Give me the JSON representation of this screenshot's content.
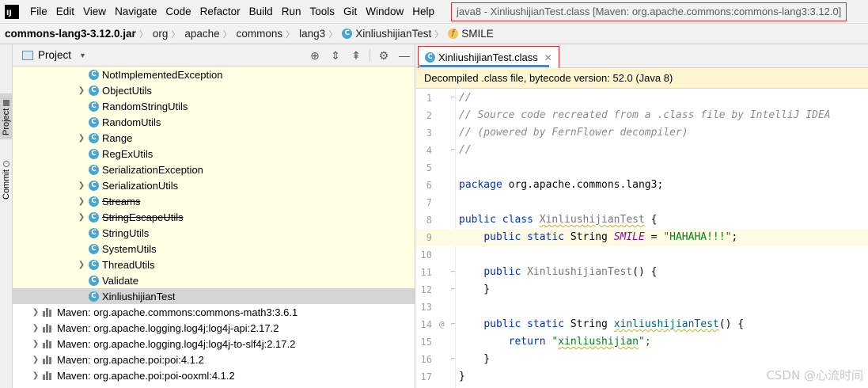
{
  "menubar": {
    "logo_text": "IJ",
    "items": [
      "File",
      "Edit",
      "View",
      "Navigate",
      "Code",
      "Refactor",
      "Build",
      "Run",
      "Tools",
      "Git",
      "Window",
      "Help"
    ],
    "window_title": "java8 - XinliushijianTest.class [Maven: org.apache.commons:commons-lang3:3.12.0]"
  },
  "breadcrumb": {
    "items": [
      "commons-lang3-3.12.0.jar",
      "org",
      "apache",
      "commons",
      "lang3",
      "XinliushijianTest",
      "SMILE"
    ],
    "icons": [
      "jar-icon",
      "package",
      "package",
      "package",
      "package",
      "class-icon",
      "field-icon"
    ]
  },
  "toolstrip": {
    "project_tab": "Project",
    "commit_tab": "Commit"
  },
  "project_panel": {
    "title": "Project",
    "toolbar_icons": [
      "locate-icon",
      "expand-all-icon",
      "collapse-all-icon",
      "gear-icon",
      "minimize-icon"
    ],
    "class_rows": [
      {
        "label": "NotImplementedException",
        "expandable": false,
        "strike": false
      },
      {
        "label": "ObjectUtils",
        "expandable": true,
        "strike": false
      },
      {
        "label": "RandomStringUtils",
        "expandable": false,
        "strike": false
      },
      {
        "label": "RandomUtils",
        "expandable": false,
        "strike": false
      },
      {
        "label": "Range",
        "expandable": true,
        "strike": false
      },
      {
        "label": "RegExUtils",
        "expandable": false,
        "strike": false
      },
      {
        "label": "SerializationException",
        "expandable": false,
        "strike": false
      },
      {
        "label": "SerializationUtils",
        "expandable": true,
        "strike": false
      },
      {
        "label": "Streams",
        "expandable": true,
        "strike": true
      },
      {
        "label": "StringEscapeUtils",
        "expandable": true,
        "strike": true
      },
      {
        "label": "StringUtils",
        "expandable": false,
        "strike": false
      },
      {
        "label": "SystemUtils",
        "expandable": false,
        "strike": false
      },
      {
        "label": "ThreadUtils",
        "expandable": true,
        "strike": false
      },
      {
        "label": "Validate",
        "expandable": false,
        "strike": false
      },
      {
        "label": "XinliushijianTest",
        "expandable": false,
        "strike": false,
        "selected": true
      }
    ],
    "library_rows": [
      "Maven: org.apache.commons:commons-math3:3.6.1",
      "Maven: org.apache.logging.log4j:log4j-api:2.17.2",
      "Maven: org.apache.logging.log4j:log4j-to-slf4j:2.17.2",
      "Maven: org.apache.poi:poi:4.1.2",
      "Maven: org.apache.poi:poi-ooxml:4.1.2"
    ]
  },
  "editor": {
    "tab_label": "XinliushijianTest.class",
    "banner": "Decompiled .class file, bytecode version: 52.0 (Java 8)",
    "current_line": 9,
    "lines": [
      {
        "n": "1",
        "mark": "",
        "fold": "⌐",
        "tokens": [
          [
            "//",
            "comment"
          ]
        ]
      },
      {
        "n": "2",
        "mark": "",
        "fold": "",
        "tokens": [
          [
            "// Source code recreated from a .class file by IntelliJ IDEA",
            "comment"
          ]
        ]
      },
      {
        "n": "3",
        "mark": "",
        "fold": "",
        "tokens": [
          [
            "// (powered by FernFlower decompiler)",
            "comment"
          ]
        ]
      },
      {
        "n": "4",
        "mark": "",
        "fold": "⌐",
        "tokens": [
          [
            "//",
            "comment"
          ]
        ]
      },
      {
        "n": "5",
        "mark": "",
        "fold": "",
        "tokens": []
      },
      {
        "n": "6",
        "mark": "",
        "fold": "",
        "tokens": [
          [
            "package",
            "kw"
          ],
          [
            " org.apache.commons.lang3;",
            "plain"
          ]
        ]
      },
      {
        "n": "7",
        "mark": "",
        "fold": "",
        "tokens": []
      },
      {
        "n": "8",
        "mark": "",
        "fold": "",
        "tokens": [
          [
            "public class ",
            "kw"
          ],
          [
            "XinliushijianTest",
            "dimwavy"
          ],
          [
            " {",
            "plain"
          ]
        ]
      },
      {
        "n": "9",
        "mark": "",
        "fold": "",
        "tokens": [
          [
            "    ",
            "plain"
          ],
          [
            "public static ",
            "kw"
          ],
          [
            "String ",
            "plain"
          ],
          [
            "SMILE",
            "field"
          ],
          [
            " = ",
            "plain"
          ],
          [
            "\"HAHAHA!!!\"",
            "str"
          ],
          [
            ";",
            "plain"
          ]
        ]
      },
      {
        "n": "10",
        "mark": "",
        "fold": "",
        "tokens": []
      },
      {
        "n": "11",
        "mark": "",
        "fold": "⌐",
        "tokens": [
          [
            "    ",
            "plain"
          ],
          [
            "public ",
            "kw"
          ],
          [
            "XinliushijianTest",
            "dim"
          ],
          [
            "() {",
            "plain"
          ]
        ]
      },
      {
        "n": "12",
        "mark": "",
        "fold": "⌐",
        "tokens": [
          [
            "    }",
            "plain"
          ]
        ]
      },
      {
        "n": "13",
        "mark": "",
        "fold": "",
        "tokens": []
      },
      {
        "n": "14",
        "mark": "@",
        "fold": "⌐",
        "tokens": [
          [
            "    ",
            "plain"
          ],
          [
            "public static ",
            "kw"
          ],
          [
            "String ",
            "plain"
          ],
          [
            "xinliushijianTest",
            "methwavy"
          ],
          [
            "() {",
            "plain"
          ]
        ]
      },
      {
        "n": "15",
        "mark": "",
        "fold": "",
        "tokens": [
          [
            "        ",
            "plain"
          ],
          [
            "return ",
            "kw"
          ],
          [
            "\"",
            "str"
          ],
          [
            "xinliushijian",
            "strwavy"
          ],
          [
            "\";",
            "str"
          ]
        ]
      },
      {
        "n": "16",
        "mark": "",
        "fold": "⌐",
        "tokens": [
          [
            "    }",
            "plain"
          ]
        ]
      },
      {
        "n": "17",
        "mark": "",
        "fold": "",
        "tokens": [
          [
            "}",
            "plain"
          ]
        ]
      }
    ]
  },
  "watermark": "CSDN @心流时间"
}
